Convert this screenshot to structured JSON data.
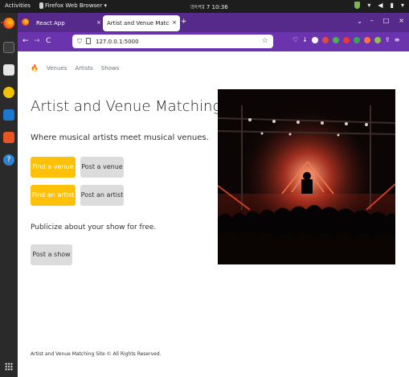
{
  "system": {
    "activities_label": "Activities",
    "app_menu_label": "Firefox Web Browser ▾",
    "clock": "তৎপর 7 10:36"
  },
  "browser": {
    "tabs": [
      {
        "label": "React App",
        "active": false
      },
      {
        "label": "Artist and Venue Matching S",
        "active": true
      }
    ],
    "new_tab_glyph": "+",
    "tab_close_glyph": "×",
    "url": "127.0.0.1:5000",
    "back_glyph": "←",
    "forward_glyph": "→",
    "reload_glyph": "C",
    "colors": {
      "tab_strip": "#552a8a",
      "nav_bar": "#6b33ad"
    }
  },
  "site": {
    "nav": [
      "Venues",
      "Artists",
      "Shows"
    ],
    "title": "Artist and Venue Matching Site",
    "title_emoji": "🔥",
    "subtitle": "Where musical artists meet musical venues.",
    "buttons": {
      "find_venue": "Find a venue",
      "post_venue": "Post a venue",
      "find_artist": "Find an artist",
      "post_artist": "Post an artist",
      "post_show": "Post a show"
    },
    "publicize": "Publicize about your show for free.",
    "footer": "Artist and Venue Matching Site © All Rights Reserved.",
    "colors": {
      "accent_button": "#ffc107",
      "secondary_button": "#dcdcdc"
    }
  }
}
